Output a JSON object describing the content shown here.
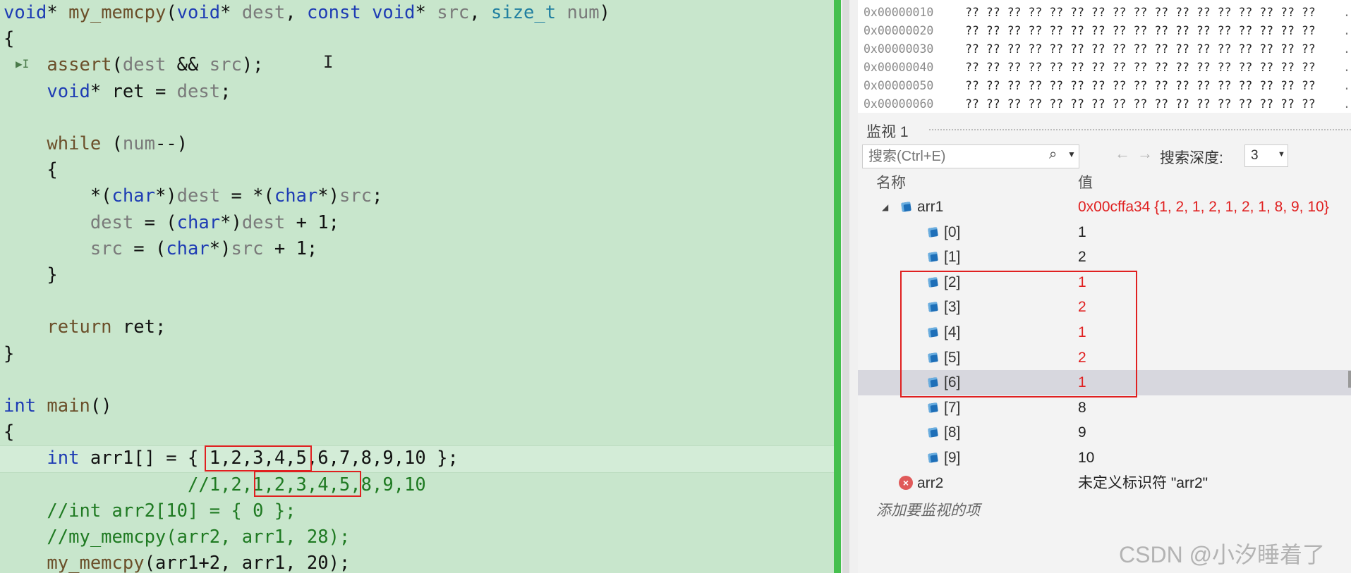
{
  "editor": {
    "lines": [
      [
        [
          "void",
          "kw"
        ],
        [
          "* ",
          ""
        ],
        [
          "my_memcpy",
          "fn"
        ],
        [
          "(",
          ""
        ],
        [
          "void",
          "kw"
        ],
        [
          "* ",
          ""
        ],
        [
          "dest",
          "pr"
        ],
        [
          ", ",
          ""
        ],
        [
          "const",
          "kw"
        ],
        [
          " ",
          ""
        ],
        [
          "void",
          "kw"
        ],
        [
          "* ",
          ""
        ],
        [
          "src",
          "pr"
        ],
        [
          ", ",
          ""
        ],
        [
          "size_t",
          "ty"
        ],
        [
          " ",
          ""
        ],
        [
          "num",
          "pr"
        ],
        [
          ")",
          ""
        ]
      ],
      [
        [
          "{",
          ""
        ]
      ],
      [
        [
          "    ",
          ""
        ],
        [
          "assert",
          "fn"
        ],
        [
          "(",
          ""
        ],
        [
          "dest",
          "pr"
        ],
        [
          " && ",
          ""
        ],
        [
          "src",
          "pr"
        ],
        [
          ");",
          ""
        ]
      ],
      [
        [
          "    ",
          ""
        ],
        [
          "void",
          "kw"
        ],
        [
          "* ret = ",
          ""
        ],
        [
          "dest",
          "pr"
        ],
        [
          ";",
          ""
        ]
      ],
      [],
      [
        [
          "    ",
          ""
        ],
        [
          "while",
          "fn"
        ],
        [
          " (",
          ""
        ],
        [
          "num",
          "pr"
        ],
        [
          "--)",
          ""
        ]
      ],
      [
        [
          "    {",
          ""
        ]
      ],
      [
        [
          "        *(",
          ""
        ],
        [
          "char",
          "kw"
        ],
        [
          "*)",
          ""
        ],
        [
          "dest",
          "pr"
        ],
        [
          " = *(",
          ""
        ],
        [
          "char",
          "kw"
        ],
        [
          "*)",
          ""
        ],
        [
          "src",
          "pr"
        ],
        [
          ";",
          ""
        ]
      ],
      [
        [
          "        ",
          ""
        ],
        [
          "dest",
          "pr"
        ],
        [
          " = (",
          ""
        ],
        [
          "char",
          "kw"
        ],
        [
          "*)",
          ""
        ],
        [
          "dest",
          "pr"
        ],
        [
          " + 1;",
          ""
        ]
      ],
      [
        [
          "        ",
          ""
        ],
        [
          "src",
          "pr"
        ],
        [
          " = (",
          ""
        ],
        [
          "char",
          "kw"
        ],
        [
          "*)",
          ""
        ],
        [
          "src",
          "pr"
        ],
        [
          " + 1;",
          ""
        ]
      ],
      [
        [
          "    }",
          ""
        ]
      ],
      [],
      [
        [
          "    ",
          ""
        ],
        [
          "return",
          "fn"
        ],
        [
          " ret;",
          ""
        ]
      ],
      [
        [
          "}",
          ""
        ]
      ],
      [],
      [
        [
          "int",
          "kw"
        ],
        [
          " ",
          ""
        ],
        [
          "main",
          "fn"
        ],
        [
          "()",
          ""
        ]
      ],
      [
        [
          "{",
          ""
        ]
      ],
      [
        [
          "    ",
          ""
        ],
        [
          "int",
          "kw"
        ],
        [
          " arr1[] = { 1,2,3,4,5,6,7,8,9,10 };",
          ""
        ]
      ],
      [
        [
          "                 //1,2,1,2,3,4,5,8,9,10",
          "cm"
        ]
      ],
      [
        [
          "    //int arr2[10] = { 0 };",
          "cm"
        ]
      ],
      [
        [
          "    //my_memcpy(arr2, arr1, 28);",
          "cm"
        ]
      ],
      [
        [
          "    ",
          ""
        ],
        [
          "my_memcpy",
          "fn"
        ],
        [
          "(arr1+2, arr1, 20);",
          ""
        ]
      ]
    ]
  },
  "memory": {
    "rows": [
      {
        "addr": "0x00000010",
        "bytes": "?? ?? ?? ?? ?? ?? ?? ?? ?? ?? ?? ?? ?? ?? ?? ?? ??",
        "tail": "."
      },
      {
        "addr": "0x00000020",
        "bytes": "?? ?? ?? ?? ?? ?? ?? ?? ?? ?? ?? ?? ?? ?? ?? ?? ??",
        "tail": "."
      },
      {
        "addr": "0x00000030",
        "bytes": "?? ?? ?? ?? ?? ?? ?? ?? ?? ?? ?? ?? ?? ?? ?? ?? ??",
        "tail": "."
      },
      {
        "addr": "0x00000040",
        "bytes": "?? ?? ?? ?? ?? ?? ?? ?? ?? ?? ?? ?? ?? ?? ?? ?? ??",
        "tail": "."
      },
      {
        "addr": "0x00000050",
        "bytes": "?? ?? ?? ?? ?? ?? ?? ?? ?? ?? ?? ?? ?? ?? ?? ?? ??",
        "tail": "."
      },
      {
        "addr": "0x00000060",
        "bytes": "?? ?? ?? ?? ?? ?? ?? ?? ?? ?? ?? ?? ?? ?? ?? ?? ??",
        "tail": "."
      }
    ]
  },
  "watch": {
    "tab_title": "监视 1",
    "search_placeholder": "搜索(Ctrl+E)",
    "search_icon": "search-icon",
    "depth_label": "搜索深度:",
    "depth_value": "3",
    "col_name": "名称",
    "col_value": "值",
    "items": [
      {
        "name": "arr1",
        "value": "0x00cffa34 {1, 2, 1, 2, 1, 2, 1, 8, 9, 10}",
        "changed": true,
        "level": 0,
        "icon": "variable-icon",
        "expanded": true
      },
      {
        "name": "[0]",
        "value": "1",
        "changed": false,
        "level": 1,
        "icon": "variable-icon"
      },
      {
        "name": "[1]",
        "value": "2",
        "changed": false,
        "level": 1,
        "icon": "variable-icon"
      },
      {
        "name": "[2]",
        "value": "1",
        "changed": true,
        "level": 1,
        "icon": "variable-icon"
      },
      {
        "name": "[3]",
        "value": "2",
        "changed": true,
        "level": 1,
        "icon": "variable-icon"
      },
      {
        "name": "[4]",
        "value": "1",
        "changed": true,
        "level": 1,
        "icon": "variable-icon"
      },
      {
        "name": "[5]",
        "value": "2",
        "changed": true,
        "level": 1,
        "icon": "variable-icon"
      },
      {
        "name": "[6]",
        "value": "1",
        "changed": true,
        "level": 1,
        "icon": "variable-icon",
        "selected": true
      },
      {
        "name": "[7]",
        "value": "8",
        "changed": false,
        "level": 1,
        "icon": "variable-icon"
      },
      {
        "name": "[8]",
        "value": "9",
        "changed": false,
        "level": 1,
        "icon": "variable-icon"
      },
      {
        "name": "[9]",
        "value": "10",
        "changed": false,
        "level": 1,
        "icon": "variable-icon"
      },
      {
        "name": "arr2",
        "value": "未定义标识符 \"arr2\"",
        "changed": false,
        "level": 0,
        "icon": "error-icon"
      }
    ],
    "add_item": "添加要监视的项"
  },
  "watermark": "CSDN @小汐睡着了",
  "colors": {
    "editor_bg": "#c8e6cc",
    "keyword": "#1e3cb4",
    "highlight_box": "#e02020",
    "changed_value": "#e02020"
  }
}
